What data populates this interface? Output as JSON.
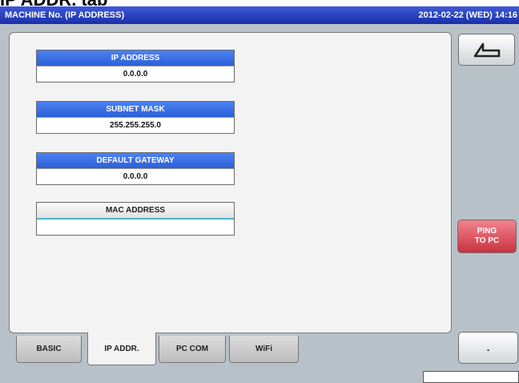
{
  "top_caption": "IP ADDR. tab",
  "titlebar": {
    "title": "MACHINE No. (IP ADDRESS)",
    "datetime": "2012-02-22 (WED)  14:16"
  },
  "fields": {
    "ip_address": {
      "label": "IP ADDRESS",
      "value": "0.0.0.0"
    },
    "subnet_mask": {
      "label": "SUBNET MASK",
      "value": "255.255.255.0"
    },
    "default_gateway": {
      "label": "DEFAULT GATEWAY",
      "value": "0.0.0.0"
    },
    "mac_address": {
      "label": "MAC ADDRESS",
      "value": ""
    }
  },
  "buttons": {
    "back_icon": "return-arrow-icon",
    "ping_line1": "PING",
    "ping_line2": "TO PC",
    "dot_label": "."
  },
  "tabs": {
    "basic": "BASIC",
    "ip_addr": "IP ADDR.",
    "pc_com": "PC COM",
    "wifi": "WiFi"
  },
  "colors": {
    "header_blue": "#3a6df0",
    "ping_red": "#d8404d",
    "mac_accent": "#4cb3c8",
    "titlebar": "#2a40c0"
  }
}
